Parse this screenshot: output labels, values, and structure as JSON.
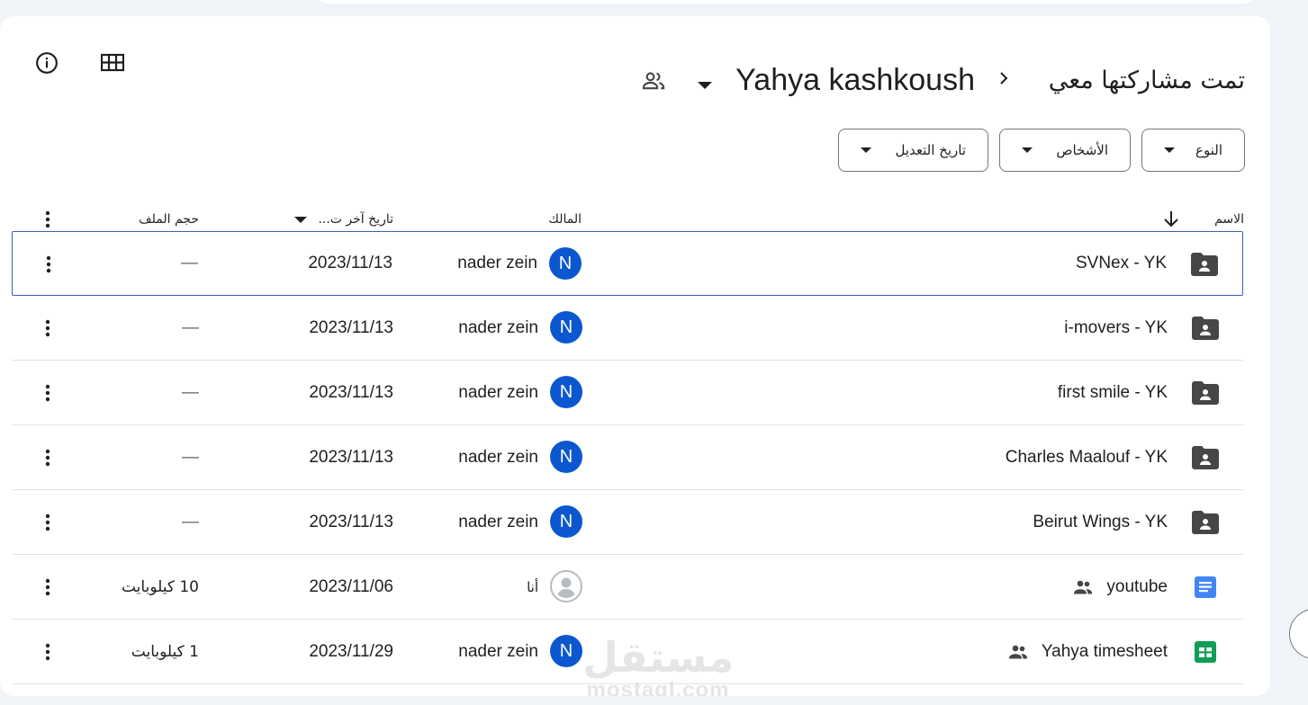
{
  "breadcrumb": {
    "root": "تمت مشاركتها معي",
    "current": "Yahya kashkoush"
  },
  "filters": {
    "type": "النوع",
    "people": "الأشخاص",
    "modified": "تاريخ التعديل"
  },
  "columns": {
    "name": "الاسم",
    "owner": "المالك",
    "last_modified": "تاريخ آخر ت...",
    "size": "حجم الملف"
  },
  "rows": [
    {
      "name": "SVNex - YK",
      "icon": "shared-folder-icon",
      "owner_initial": "N",
      "owner": "nader zein",
      "date": "2023/11/13",
      "size": "—",
      "selected": true
    },
    {
      "name": "i-movers - YK",
      "icon": "shared-folder-icon",
      "owner_initial": "N",
      "owner": "nader zein",
      "date": "2023/11/13",
      "size": "—"
    },
    {
      "name": "first smile - YK",
      "icon": "shared-folder-icon",
      "owner_initial": "N",
      "owner": "nader zein",
      "date": "2023/11/13",
      "size": "—"
    },
    {
      "name": "Charles Maalouf - YK",
      "icon": "shared-folder-icon",
      "owner_initial": "N",
      "owner": "nader zein",
      "date": "2023/11/13",
      "size": "—"
    },
    {
      "name": "Beirut Wings - YK",
      "icon": "shared-folder-icon",
      "owner_initial": "N",
      "owner": "nader zein",
      "date": "2023/11/13",
      "size": "—"
    },
    {
      "name": "youtube",
      "icon": "google-docs-icon",
      "owner_initial": "",
      "owner": "أنا",
      "date": "2023/11/06",
      "size": "10 كيلوبايت",
      "shared": true
    },
    {
      "name": "Yahya timesheet",
      "icon": "google-sheets-icon",
      "owner_initial": "N",
      "owner": "nader zein",
      "date": "2023/11/29",
      "size": "1 كيلوبايت",
      "shared": true
    }
  ],
  "watermark": {
    "arabic": "مستقل",
    "latin": "mostaql.com"
  },
  "colors": {
    "accent": "#0b57d0",
    "folder": "#444746",
    "docs": "#4285f4",
    "sheets": "#0f9d58"
  }
}
